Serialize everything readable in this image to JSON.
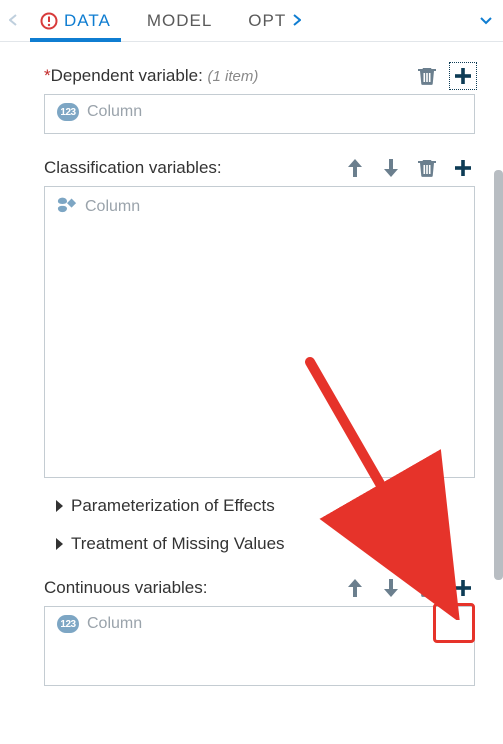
{
  "tabs": {
    "items": [
      {
        "label": "DATA",
        "active": true,
        "hasError": true
      },
      {
        "label": "MODEL",
        "active": false,
        "hasError": false
      },
      {
        "label": "OPT",
        "active": false,
        "hasError": false
      }
    ]
  },
  "sections": {
    "dependent": {
      "label": "Dependent variable:",
      "required": true,
      "countText": "(1 item)",
      "actions": {
        "delete": true,
        "add": true
      },
      "placeholder": "Column",
      "placeholderIcon": "numeric-123"
    },
    "classification": {
      "label": "Classification variables:",
      "actions": {
        "moveUp": true,
        "moveDown": true,
        "delete": true,
        "add": true
      },
      "placeholder": "Column",
      "placeholderIcon": "character"
    },
    "continuous": {
      "label": "Continuous variables:",
      "actions": {
        "moveUp": true,
        "moveDown": true,
        "delete": true,
        "add": true
      },
      "placeholder": "Column",
      "placeholderIcon": "numeric-123"
    }
  },
  "disclosures": {
    "param": {
      "label": "Parameterization of Effects"
    },
    "missing": {
      "label": "Treatment of Missing Values"
    }
  },
  "annotation": {
    "arrowColor": "#e6332a"
  }
}
